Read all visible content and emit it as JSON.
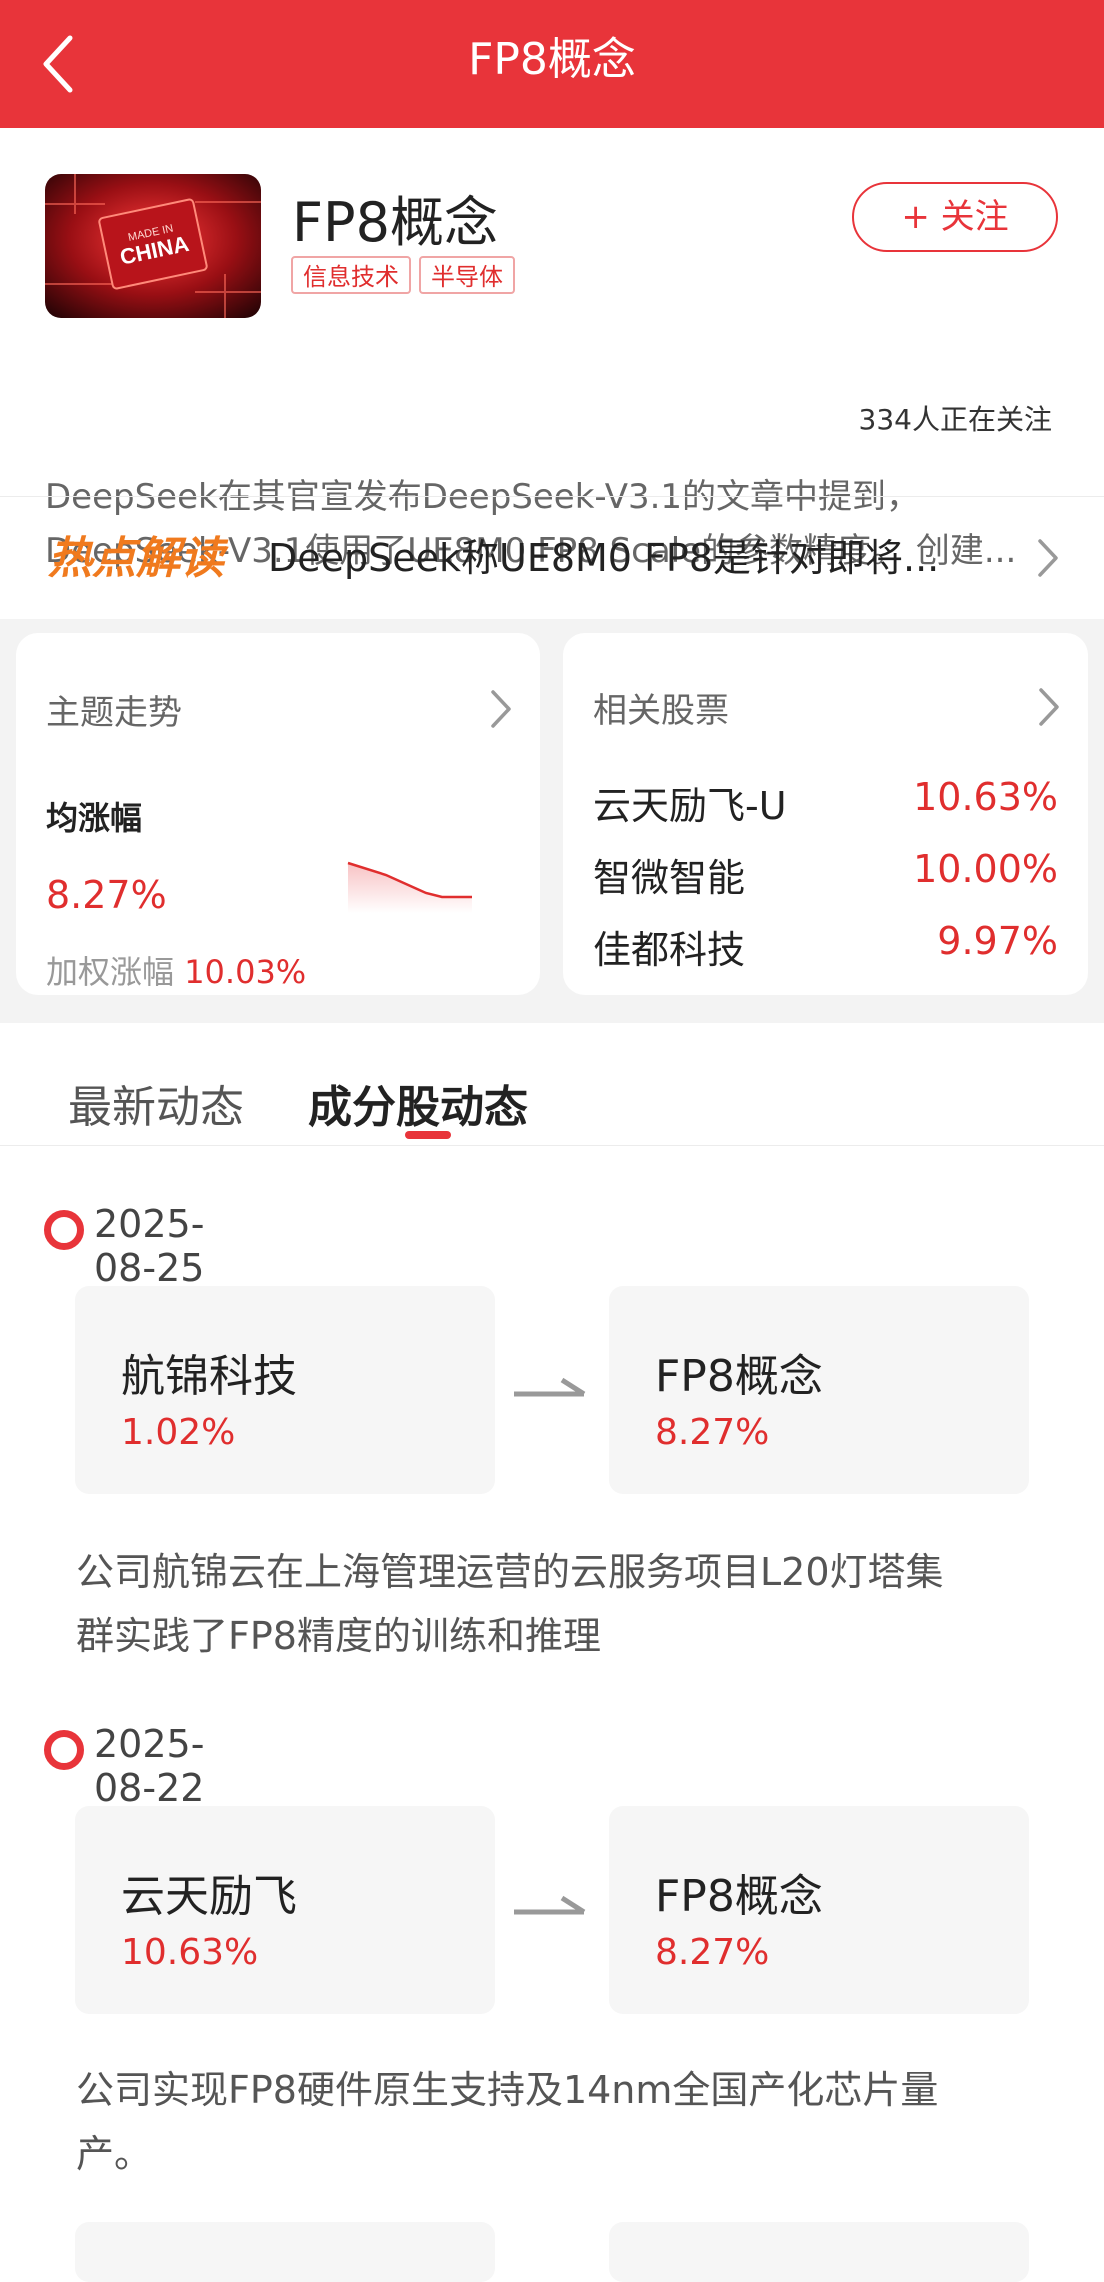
{
  "nav": {
    "title": "FP8概念"
  },
  "header": {
    "topic_name": "FP8概念",
    "logo_text": "MADE IN CHINA",
    "tags": [
      "信息技术",
      "半导体"
    ],
    "follow_label": "+ 关注",
    "follow_count": "334人正在关注",
    "description_line1": "DeepSeek在其官宣发布DeepSeek-V3.1的文章中提到，",
    "description_line2": "DeepSeek-V3.1使用了UE8M0 FP8 Scale的参数精度。 创建..."
  },
  "hot": {
    "badge": "热点解读",
    "text": "DeepSeek称UE8M0 FP8是针对即将..."
  },
  "trend_card": {
    "title": "主题走势",
    "avg_label": "均涨幅",
    "avg_value": "8.27%",
    "weighted_label": "加权涨幅",
    "weighted_value": "10.03%"
  },
  "related_card": {
    "title": "相关股票",
    "stocks": [
      {
        "name": "云天励飞-U",
        "pct": "10.63%"
      },
      {
        "name": "智微智能",
        "pct": "10.00%"
      },
      {
        "name": "佳都科技",
        "pct": "9.97%"
      }
    ]
  },
  "tabs": [
    {
      "label": "最新动态"
    },
    {
      "label": "成分股动态"
    }
  ],
  "timeline": [
    {
      "date": "2025-08-25",
      "from_name": "航锦科技",
      "from_pct": "1.02%",
      "to_name": "FP8概念",
      "to_pct": "8.27%",
      "reason_line1": "公司航锦云在上海管理运营的云服务项目L20灯塔集",
      "reason_line2": "群实践了FP8精度的训练和推理"
    },
    {
      "date": "2025-08-22",
      "from_name": "云天励飞",
      "from_pct": "10.63%",
      "to_name": "FP8概念",
      "to_pct": "8.27%",
      "reason_line1": "公司实现FP8硬件原生支持及14nm全国产化芯片量",
      "reason_line2": "产。"
    }
  ],
  "colors": {
    "brand_red": "#e8343a",
    "rise_red": "#e02e2e"
  }
}
